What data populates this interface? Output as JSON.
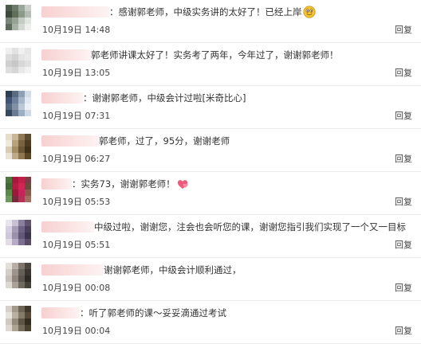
{
  "reply_label": "回复",
  "comments": [
    {
      "nick_width": 85,
      "text": "：感谢郭老师，中级实务讲的太好了！已经上岸",
      "emoji": "smiley-emoji",
      "time": "10月19日 14:48",
      "avatar_colors": [
        "#4e5a4c",
        "#6b7a6a",
        "#9aa69a",
        "#c9cfc8",
        "#3c4a3b",
        "#5f6f5c",
        "#8c9a8a",
        "#b4bdb3",
        "#7a8679",
        "#98a397",
        "#c5ccc4",
        "#e1e5e0",
        "#5c6a5b",
        "#a7b1a6",
        "#d3d8d2",
        "#eef0ed"
      ]
    },
    {
      "nick_width": 62,
      "text": "郭老师讲课太好了！实务考了两年，今年过了，谢谢郭老师！",
      "emoji": "",
      "time": "10月19日 13:05",
      "avatar_colors": [
        "#eeeeee",
        "#e2e2e2",
        "#f0f0f0",
        "#e6e6e6",
        "#dcdcdc",
        "#d3d3d3",
        "#e4e4e4",
        "#eaeaea",
        "#cfcfcf",
        "#c8c8c8",
        "#d8d8d8",
        "#e0e0e0",
        "#dedede",
        "#d6d6d6",
        "#e9e9e9",
        "#f2f2f2"
      ]
    },
    {
      "nick_width": 52,
      "text": "：谢谢郭老师，中级会计过啦[米奇比心]",
      "emoji": "",
      "time": "10月19日 07:31",
      "avatar_colors": [
        "#2d3e55",
        "#5a6b82",
        "#8fa0b5",
        "#d3dbe5",
        "#405573",
        "#6f819a",
        "#a7b6c8",
        "#e2e8ef",
        "#54687f",
        "#8192a8",
        "#bcc8d6",
        "#eef2f6",
        "#35485f",
        "#6a7c93",
        "#9caec2",
        "#cfd9e4"
      ]
    },
    {
      "nick_width": 72,
      "text": "郭老师，过了，95分，谢谢老师",
      "emoji": "",
      "time": "10月19日 06:27",
      "avatar_colors": [
        "#e6dccb",
        "#c9b695",
        "#8e7a56",
        "#5d4e33",
        "#f0e8dc",
        "#b7a17a",
        "#7a6440",
        "#4a3b22",
        "#d9ccb6",
        "#a48c63",
        "#6b5534",
        "#3d2f1a",
        "#eae2d4",
        "#c0ab87",
        "#8d7650",
        "#5a4728"
      ]
    },
    {
      "nick_width": 38,
      "text": "：实务73，谢谢郭老师！",
      "emoji": "heart-emoji",
      "time": "10月19日 05:53",
      "avatar_colors": [
        "#4c7a3e",
        "#a8173c",
        "#c21e4a",
        "#7d3a45",
        "#3f6a33",
        "#b51b44",
        "#d42456",
        "#6a4a3a",
        "#5a8a4a",
        "#9a1a3a",
        "#c8245a",
        "#8a5a4a",
        "#6b9a5b",
        "#7a2a3e",
        "#b8305a",
        "#a07060"
      ]
    },
    {
      "nick_width": 66,
      "text": "中级过啦，谢谢您，注会也会听您的课，谢谢您指引我们实现了一个又一目标",
      "emoji": "",
      "time": "10月19日 05:51",
      "avatar_colors": [
        "#e8e4ee",
        "#c8c0d4",
        "#8a7f9c",
        "#5e5470",
        "#d6cfe0",
        "#a79cb8",
        "#6f6483",
        "#4a405c",
        "#cfc6da",
        "#9b8fae",
        "#625775",
        "#3d3450",
        "#e2dce9",
        "#b6abc6",
        "#7c7090",
        "#584c6a"
      ]
    },
    {
      "nick_width": 78,
      "text": "谢谢郭老师，中级会计顺利通过，",
      "emoji": "",
      "time": "10月19日 00:08",
      "avatar_colors": [
        "#e3e0dc",
        "#b8b0a8",
        "#7d766e",
        "#4c4640",
        "#d2cdc6",
        "#9d958c",
        "#665f58",
        "#3a3530",
        "#c8c2ba",
        "#8e867e",
        "#5a544e",
        "#2e2a26",
        "#dcd8d2",
        "#aaa298",
        "#70695f",
        "#45403a"
      ]
    },
    {
      "nick_width": 48,
      "text": "：听了郭老师的课～妥妥滴通过考试",
      "emoji": "",
      "time": "10月19日 00:04",
      "avatar_colors": [
        "#d5d0c8",
        "#a39a8c",
        "#6e6556",
        "#3f382c",
        "#e6e2dc",
        "#b9b0a2",
        "#857b6b",
        "#55493a",
        "#cfc9bf",
        "#958b7c",
        "#5f5546",
        "#342c20",
        "#ddd8d0",
        "#aca393",
        "#766c5c",
        "#4a4032"
      ]
    }
  ]
}
